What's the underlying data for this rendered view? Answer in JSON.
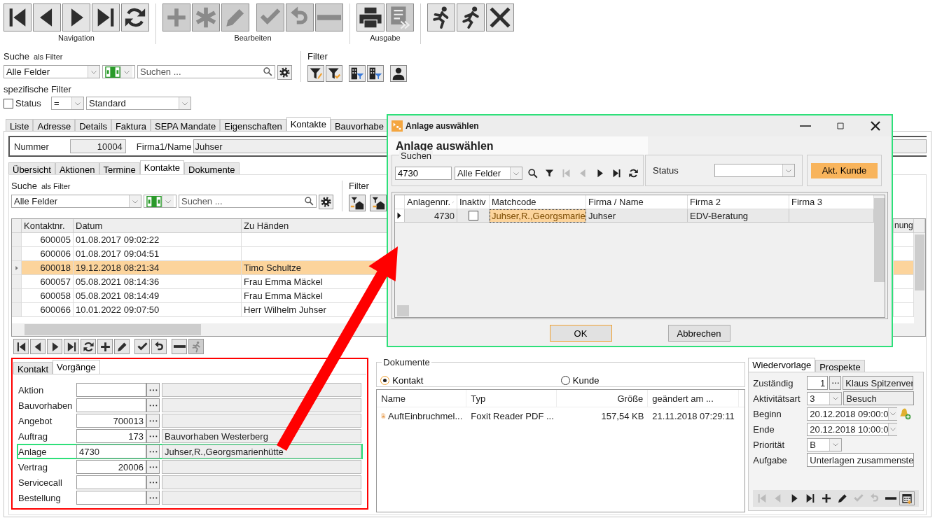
{
  "toolbar": [
    {
      "label": "Navigation",
      "buttons": [
        {
          "kind": "first",
          "disabled": false
        },
        {
          "kind": "prev",
          "disabled": false
        },
        {
          "kind": "next",
          "disabled": false
        },
        {
          "kind": "last",
          "disabled": false
        },
        {
          "kind": "refresh",
          "disabled": false
        }
      ]
    },
    {
      "label": "Bearbeiten",
      "buttons": [
        {
          "kind": "plus",
          "disabled": true
        },
        {
          "kind": "asterisk",
          "disabled": true
        },
        {
          "kind": "pencil",
          "disabled": true
        },
        {
          "kind": "check",
          "disabled": true
        },
        {
          "kind": "undo",
          "disabled": true
        },
        {
          "kind": "minus",
          "disabled": true
        }
      ]
    },
    {
      "label": "Ausgabe",
      "buttons": [
        {
          "kind": "printer",
          "disabled": false
        },
        {
          "kind": "export",
          "disabled": true
        }
      ]
    },
    {
      "buttons": [
        {
          "kind": "runner",
          "disabled": false
        },
        {
          "kind": "runner2",
          "disabled": false
        },
        {
          "kind": "close",
          "disabled": false
        }
      ]
    }
  ],
  "search": {
    "label": "Suche",
    "hint": "als Filter",
    "field_select": "Alle Felder",
    "placeholder": "Suchen ..."
  },
  "filter": {
    "label": "Filter",
    "buttons": [
      {
        "kind": "funnel-edit"
      },
      {
        "kind": "funnel-check"
      },
      {
        "kind": "building-funnel"
      },
      {
        "kind": "building-funnel"
      },
      {
        "kind": "person"
      }
    ]
  },
  "specific_filter": {
    "label": "spezifische Filter",
    "status_label": "Status",
    "status_checked": false,
    "operator": "=",
    "value": "Standard"
  },
  "tabs": [
    {
      "label": "Liste",
      "selected": false
    },
    {
      "label": "Adresse",
      "selected": false
    },
    {
      "label": "Details",
      "selected": false
    },
    {
      "label": "Faktura",
      "selected": false
    },
    {
      "label": "SEPA Mandate",
      "selected": false
    },
    {
      "label": "Eigenschaften",
      "selected": false
    },
    {
      "label": "Kontakte",
      "selected": true
    },
    {
      "label": "Bauvorhabe",
      "selected": false
    }
  ],
  "record": {
    "number_label": "Nummer",
    "number": "10004",
    "name_label": "Firma1/Name",
    "name": "Juhser"
  },
  "subtabs": [
    {
      "label": "Übersicht",
      "selected": false
    },
    {
      "label": "Aktionen",
      "selected": false
    },
    {
      "label": "Termine",
      "selected": false
    },
    {
      "label": "Kontakte",
      "selected": true
    },
    {
      "label": "Dokumente",
      "selected": false
    }
  ],
  "contact_search": {
    "label": "Suche",
    "hint": "als Filter",
    "field_select": "Alle Felder",
    "placeholder": "Suchen ...",
    "filter_label": "Filter",
    "filter_buttons": [
      {
        "kind": "mail-in"
      },
      {
        "kind": "mail-out"
      }
    ]
  },
  "contacts_table": {
    "columns": [
      "Kontaktnr.",
      "Datum",
      "Zu Händen",
      "nung"
    ],
    "rows": [
      {
        "cells": [
          "600005",
          "01.08.2017 09:02:22"
        ],
        "selected": false
      },
      {
        "cells": [
          "600006",
          "01.08.2017 09:04:51"
        ],
        "selected": false
      },
      {
        "cells": [
          "600018",
          "19.12.2018 08:21:34",
          "Timo Schultze"
        ],
        "selected": true
      },
      {
        "cells": [
          "600057",
          "05.08.2021 08:14:36",
          "Frau Emma Mäckel"
        ],
        "selected": false
      },
      {
        "cells": [
          "600058",
          "05.08.2021 08:14:49",
          "Frau Emma Mäckel"
        ],
        "selected": false
      },
      {
        "cells": [
          "600066",
          "10.01.2022 09:07:50",
          "Herr Wilhelm Juhser"
        ],
        "selected": false
      }
    ]
  },
  "record_toolbar": [
    {
      "kind": "first",
      "disabled": false
    },
    {
      "kind": "prev",
      "disabled": false
    },
    {
      "kind": "next",
      "disabled": false
    },
    {
      "kind": "last",
      "disabled": false
    },
    {
      "kind": "refresh",
      "disabled": false
    },
    {
      "kind": "plus",
      "disabled": false
    },
    {
      "kind": "pencil",
      "disabled": false
    },
    {
      "kind": "check",
      "disabled": false
    },
    {
      "kind": "undo",
      "disabled": false
    },
    {
      "kind": "minus",
      "disabled": false
    },
    {
      "kind": "runner",
      "disabled": true
    }
  ],
  "detail_tabs": [
    {
      "label": "Kontakt",
      "selected": false
    },
    {
      "label": "Vorgänge",
      "selected": true
    }
  ],
  "links": [
    {
      "label": "Aktion",
      "focused": false
    },
    {
      "label": "Bauvorhaben",
      "focused": false
    },
    {
      "label": "Angebot",
      "value": "700013",
      "focused": false
    },
    {
      "label": "Auftrag",
      "value": "173",
      "description": "Bauvorhaben Westerberg",
      "focused": false
    },
    {
      "label": "Anlage",
      "value": "4730",
      "description": "Juhser,R.,Georgsmarienhütte",
      "focused": true
    },
    {
      "label": "Vertrag",
      "value": "20006",
      "focused": false
    },
    {
      "label": "Servicecall",
      "focused": false
    },
    {
      "label": "Bestellung",
      "focused": false
    }
  ],
  "documents": {
    "title": "Dokumente",
    "options": [
      {
        "label": "Kontakt",
        "selected": true
      },
      {
        "label": "Kunde",
        "selected": false
      }
    ],
    "columns": [
      "Name",
      "Typ",
      "Größe",
      "geändert am ..."
    ],
    "rows": [
      {
        "cells": [
          "AuftEinbruchmel...",
          "Foxit Reader PDF ...",
          "157,54 KB",
          "21.11.2018 07:29:11"
        ]
      }
    ]
  },
  "followup": {
    "tabs": [
      {
        "label": "Wiedervorlage",
        "selected": true
      },
      {
        "label": "Prospekte",
        "selected": false
      }
    ],
    "fields": [
      {
        "label": "Zuständig",
        "kind": "lookup",
        "value": "1",
        "description": "Klaus Spitzenver"
      },
      {
        "label": "Aktivitätsart",
        "kind": "combo",
        "value": "3",
        "description": "Besuch"
      },
      {
        "label": "Beginn",
        "kind": "date",
        "value": "20.12.2018 09:00:0",
        "alarm": true
      },
      {
        "label": "Ende",
        "kind": "date",
        "value": "20.12.2018 10:00:0",
        "alarm": false
      },
      {
        "label": "Priorität",
        "kind": "combo",
        "value": "B"
      },
      {
        "label": "Aufgabe",
        "kind": "text",
        "value": "Unterlagen zusammenste"
      }
    ],
    "toolbar": [
      {
        "kind": "first",
        "disabled": true
      },
      {
        "kind": "prev",
        "disabled": true
      },
      {
        "kind": "next",
        "disabled": false
      },
      {
        "kind": "last",
        "disabled": false
      },
      {
        "kind": "plus",
        "disabled": false
      },
      {
        "kind": "pencil",
        "disabled": false
      },
      {
        "kind": "check",
        "disabled": true
      },
      {
        "kind": "undo",
        "disabled": true
      },
      {
        "kind": "minus",
        "disabled": false
      },
      {
        "kind": "calendar",
        "disabled": false
      }
    ]
  },
  "dialog": {
    "title": "Anlage auswählen",
    "heading": "Anlage auswählen",
    "search_label": "Suchen",
    "search_value": "4730",
    "field_select": "Alle Felder",
    "nav": [
      {
        "kind": "search",
        "disabled": false
      },
      {
        "kind": "funnel",
        "disabled": false
      },
      {
        "kind": "first",
        "disabled": true
      },
      {
        "kind": "prev",
        "disabled": true
      },
      {
        "kind": "next",
        "disabled": false
      },
      {
        "kind": "last",
        "disabled": false
      },
      {
        "kind": "refresh",
        "disabled": false
      }
    ],
    "status_label": "Status",
    "customer_button": "Akt. Kunde",
    "columns": [
      "Anlagennr.",
      "Inaktiv",
      "Matchcode",
      "Firma / Name",
      "Firma 2",
      "Firma 3"
    ],
    "rows": [
      {
        "selected": true,
        "number": "4730",
        "inactive": false,
        "matchcode": "Juhser,R.,Georgsmarie",
        "name": "Juhser",
        "company_2": "EDV-Beratung"
      }
    ],
    "buttons": [
      {
        "label": "OK",
        "default": true
      },
      {
        "label": "Abbrechen",
        "default": false
      }
    ]
  }
}
